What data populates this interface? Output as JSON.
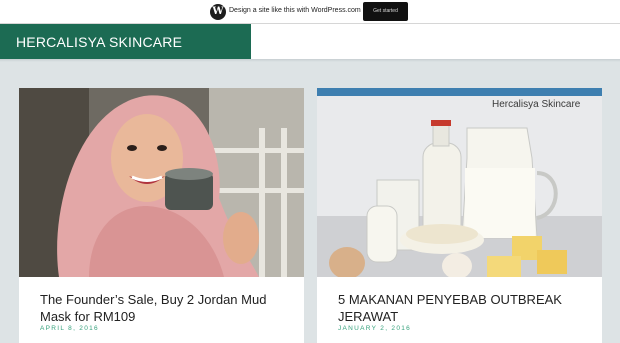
{
  "wordpress_bar": {
    "logo_glyph": "W",
    "text": "Design a site like this with WordPress.com",
    "cta_label": "Get started"
  },
  "site": {
    "title": "HERCALISYA SKINCARE",
    "brand_color": "#1c6b53",
    "accent_color": "#37a27d"
  },
  "posts": [
    {
      "title": "The Founder’s Sale, Buy 2 Jordan Mud Mask for RM109",
      "date": "APRIL 8, 2016",
      "image": "photo-woman-hijab-holding-jar"
    },
    {
      "title": "5 MAKANAN PENYEBAB OUTBREAK JERAWAT",
      "date": "JANUARY 2, 2016",
      "image": "photo-dairy-products",
      "image_watermark": "Hercalisya Skincare"
    }
  ]
}
